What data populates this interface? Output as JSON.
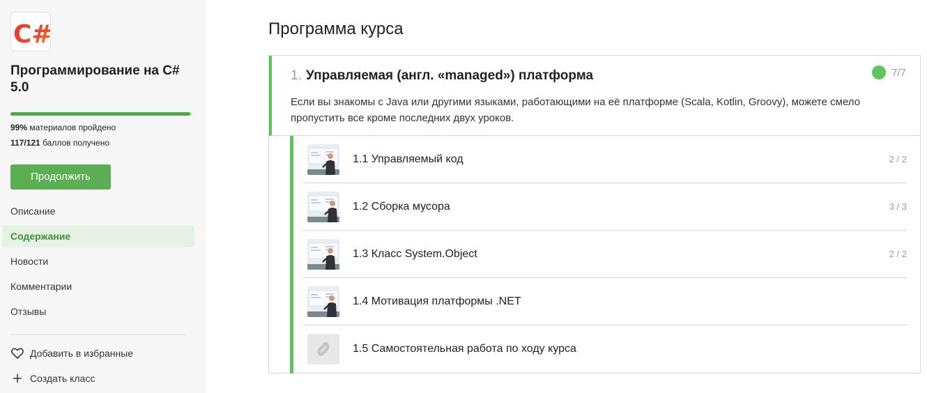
{
  "sidebar": {
    "logo_text": "C#",
    "course_title": "Программирование на C# 5.0",
    "progress_fraction": 0.99,
    "materials_percent": "99%",
    "materials_label": "материалов пройдено",
    "points_value": "117/121",
    "points_label": "баллов получено",
    "continue_label": "Продолжить",
    "nav": [
      {
        "label": "Описание",
        "active": false
      },
      {
        "label": "Содержание",
        "active": true
      },
      {
        "label": "Новости",
        "active": false
      },
      {
        "label": "Комментарии",
        "active": false
      },
      {
        "label": "Отзывы",
        "active": false
      }
    ],
    "favorite_label": "Добавить в избранные",
    "create_class_label": "Создать класс"
  },
  "main": {
    "title": "Программа курса",
    "module": {
      "number": "1.",
      "name": "Управляемая (англ. «managed») платформа",
      "description": "Если вы знакомы с Java или другими языками, работающими на её платформе (Scala, Kotlin, Groovy), можете смело пропустить все кроме последних двух уроков.",
      "count": "7/7",
      "status_icon": "completed-circle-icon",
      "lessons": [
        {
          "title": "1.1 Управляемый код",
          "score": "2 / 2",
          "thumb": "video-thumbnail"
        },
        {
          "title": "1.2 Сборка мусора",
          "score": "3 / 3",
          "thumb": "video-thumbnail"
        },
        {
          "title": "1.3 Класс System.Object",
          "score": "2 / 2",
          "thumb": "video-thumbnail"
        },
        {
          "title": "1.4 Мотивация платформы .NET",
          "score": "",
          "thumb": "video-thumbnail"
        },
        {
          "title": "1.5 Самостоятельная работа по ходу курса",
          "score": "",
          "thumb": "link-placeholder-icon"
        }
      ]
    }
  },
  "colors": {
    "accent_green": "#5cae52",
    "completed_green": "#5cc65a",
    "active_nav_bg": "#e6f3e4",
    "logo_red": "#e8392f",
    "logo_orange": "#f0a52a"
  }
}
